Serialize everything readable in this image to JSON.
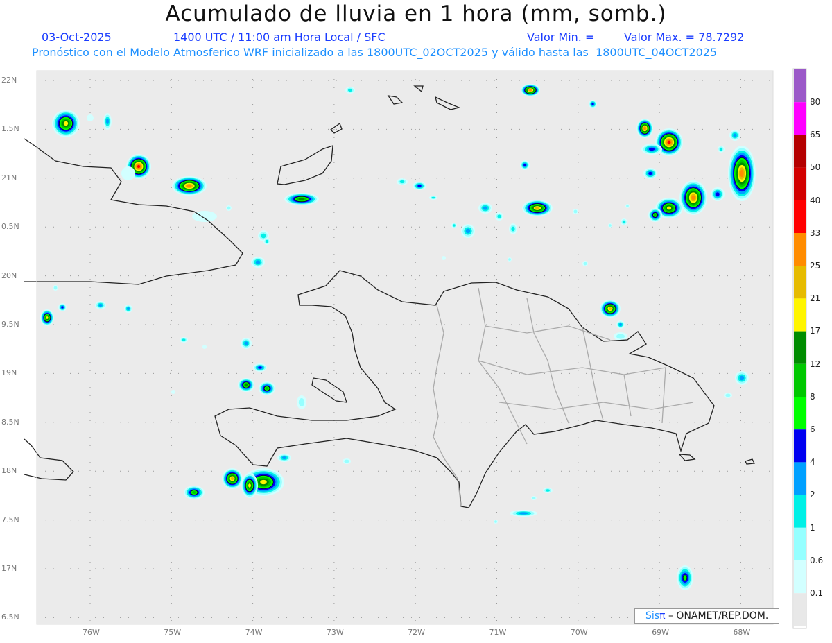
{
  "header": {
    "title": "Acumulado de lluvia en 1 hora (mm, somb.)",
    "date": "03-Oct-2025",
    "time": "1400 UTC / 11:00 am Hora Local / SFC",
    "valor_min": "Valor Min. =",
    "valor_max": "Valor Max. = 78.7292",
    "forecast_note": "Pronóstico con el Modelo Atmosferico WRF inicializado a las 1800UTC_02OCT2025 y válido hasta las  1800UTC_04OCT2025"
  },
  "axes": {
    "lat_labels": [
      "22N",
      "1.5N",
      "21N",
      "0.5N",
      "20N",
      "9.5N",
      "19N",
      "8.5N",
      "18N",
      "7.5N",
      "17N",
      "6.5N"
    ],
    "lon_labels": [
      "76W",
      "75W",
      "74W",
      "73W",
      "72W",
      "71W",
      "70W",
      "69W",
      "68W"
    ]
  },
  "colorbar": {
    "labels": [
      "80",
      "65",
      "50",
      "40",
      "33",
      "25",
      "21",
      "17",
      "12",
      "8",
      "6",
      "4",
      "2",
      "1",
      "0.6",
      "0.1"
    ],
    "colors": [
      "#9b59c8",
      "#ff00ff",
      "#b40000",
      "#d20000",
      "#ff0000",
      "#ff8c00",
      "#e6bb00",
      "#fff500",
      "#008c00",
      "#00c800",
      "#00ff00",
      "#0000f0",
      "#00a0ff",
      "#00f0e6",
      "#96ffff",
      "#d2ffff",
      "#e8e8e8"
    ]
  },
  "credit": {
    "brand": "Sis",
    "brand_symbol": "π",
    "text": "– ONAMET/REP.DOM."
  }
}
